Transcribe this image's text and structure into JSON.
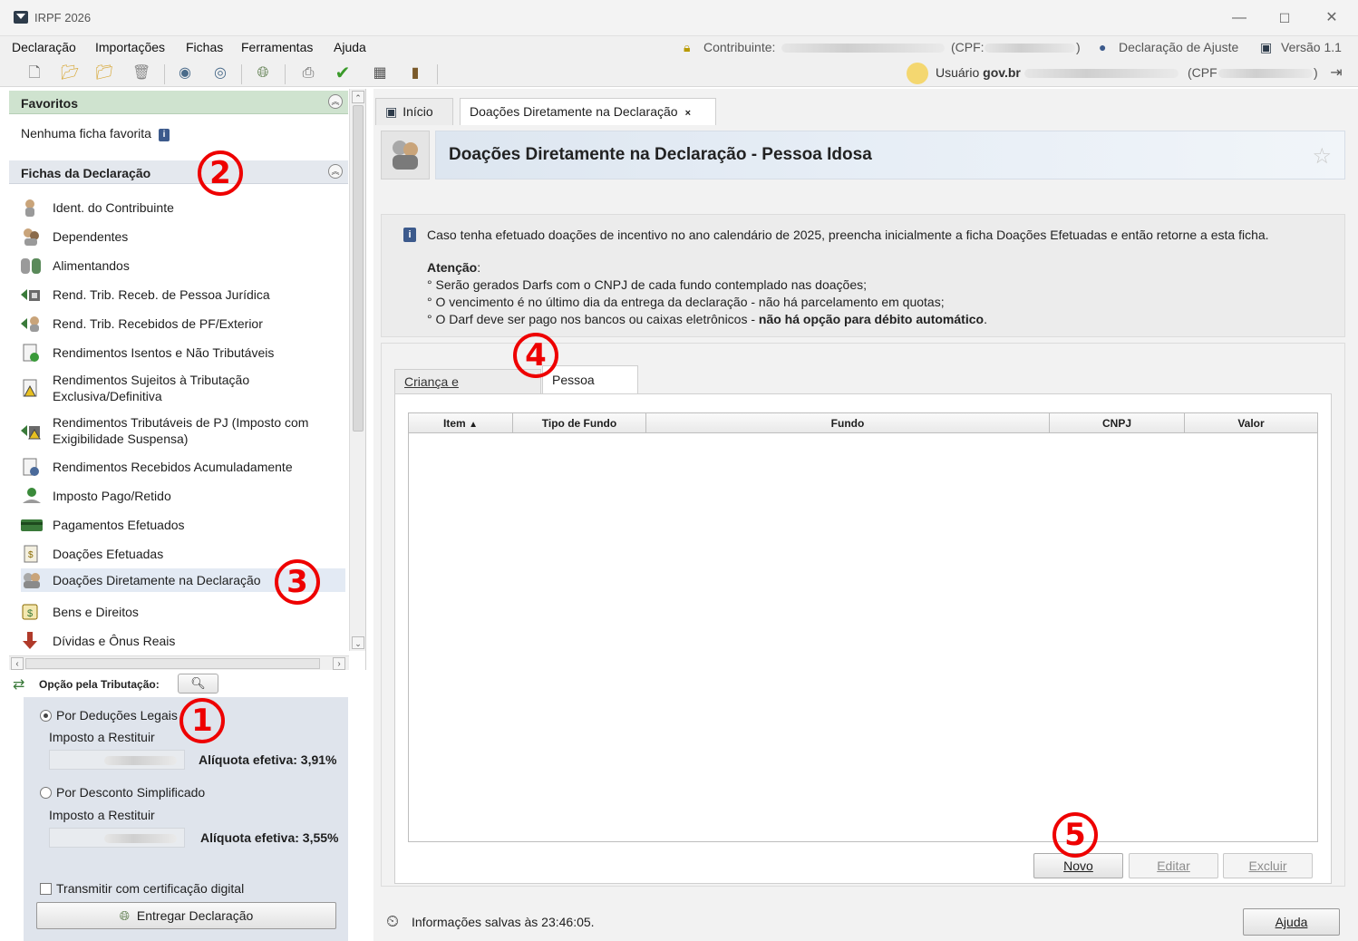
{
  "window": {
    "title": "IRPF 2026"
  },
  "menu": [
    "Declaração",
    "Importações",
    "Fichas",
    "Ferramentas",
    "Ajuda"
  ],
  "header_info": {
    "contribuinte_label": "Contribuinte:",
    "cpf_label": "(CPF:",
    "cpf_close": ")",
    "declaracao": "Declaração de Ajuste",
    "versao": "Versão 1.1",
    "usuario_label": "Usuário",
    "usuario_bold": "gov.br",
    "usuario_cpf_label": "(CPF",
    "usuario_cpf_close": ")"
  },
  "toolbar_icons": [
    "new-file-icon",
    "open-folder-icon",
    "folder-icon",
    "trash-icon",
    "transmit-icon",
    "receive-icon",
    "globe-icon",
    "print-icon",
    "check-icon",
    "calculator-icon",
    "help-book-icon"
  ],
  "favoritos": {
    "title": "Favoritos",
    "empty": "Nenhuma ficha favorita"
  },
  "fichas": {
    "title": "Fichas da Declaração",
    "items": [
      {
        "label": "Ident. do Contribuinte",
        "icon": "person-icon"
      },
      {
        "label": "Dependentes",
        "icon": "dependents-icon"
      },
      {
        "label": "Alimentandos",
        "icon": "alimentandos-icon"
      },
      {
        "label": "Rend. Trib. Receb. de Pessoa Jurídica",
        "icon": "income-pj-icon"
      },
      {
        "label": "Rend. Trib. Recebidos de PF/Exterior",
        "icon": "income-pf-icon"
      },
      {
        "label": "Rendimentos Isentos e Não Tributáveis",
        "icon": "exempt-income-icon"
      },
      {
        "label": "Rendimentos Sujeitos à Tributação",
        "label2": "Exclusiva/Definitiva",
        "icon": "exclusive-income-icon"
      },
      {
        "label": "Rendimentos Tributáveis de PJ (Imposto com",
        "label2": "Exigibilidade Suspensa)",
        "icon": "suspended-income-icon"
      },
      {
        "label": "Rendimentos Recebidos Acumuladamente",
        "icon": "accumulated-income-icon"
      },
      {
        "label": "Imposto Pago/Retido",
        "icon": "tax-paid-icon"
      },
      {
        "label": "Pagamentos Efetuados",
        "icon": "payments-icon"
      },
      {
        "label": "Doações Efetuadas",
        "icon": "donations-icon"
      },
      {
        "label": "Doações Diretamente na Declaração",
        "icon": "direct-donations-icon"
      },
      {
        "label": "Bens e Direitos",
        "icon": "assets-icon"
      },
      {
        "label": "Dívidas e Ônus Reais",
        "icon": "debts-icon"
      }
    ]
  },
  "tributacao": {
    "label": "Opção pela Tributação:",
    "deducoes": "Por Deduções Legais",
    "imposto_restituir_1": "Imposto a Restituir",
    "aliquota_1": "Alíquota efetiva: 3,91%",
    "simplificado": "Por Desconto Simplificado",
    "imposto_restituir_2": "Imposto a Restituir",
    "aliquota_2": "Alíquota efetiva: 3,55%",
    "certificacao": "Transmitir com certificação digital",
    "entregar": "Entregar Declaração"
  },
  "tabs": {
    "inicio": "Início",
    "doacoes": "Doações Diretamente na Declaração",
    "close": "×"
  },
  "page_header": {
    "title": "Doações Diretamente na Declaração - Pessoa Idosa"
  },
  "notice": {
    "line1": "Caso tenha efetuado doações de incentivo no ano calendário de 2025, preencha inicialmente a ficha Doações Efetuadas e então retorne a esta ficha.",
    "atencao": "Atenção",
    "atencao_colon": ":",
    "b1": "° Serão gerados Darfs com o CNPJ de cada fundo contemplado nas doações;",
    "b2": "° O vencimento é no último dia da entrega da declaração - não há parcelamento em quotas;",
    "b3_start": "° O Darf deve ser pago nos bancos ou caixas eletrônicos - ",
    "b3_bold": "não há opção para débito automático",
    "b3_end": "."
  },
  "subtabs": {
    "crianca": "Criança e Adolescente",
    "idosa": "Pessoa Idosa"
  },
  "table": {
    "columns": [
      "Item",
      "Tipo de Fundo",
      "Fundo",
      "CNPJ",
      "Valor"
    ],
    "sort_indicator": "▲",
    "rows": []
  },
  "buttons": {
    "novo": "Novo",
    "editar": "Editar",
    "excluir": "Excluir",
    "ajuda": "Ajuda"
  },
  "status": {
    "text": "Informações salvas às 23:46:05."
  },
  "annotations": [
    "1",
    "2",
    "3",
    "4",
    "5"
  ]
}
